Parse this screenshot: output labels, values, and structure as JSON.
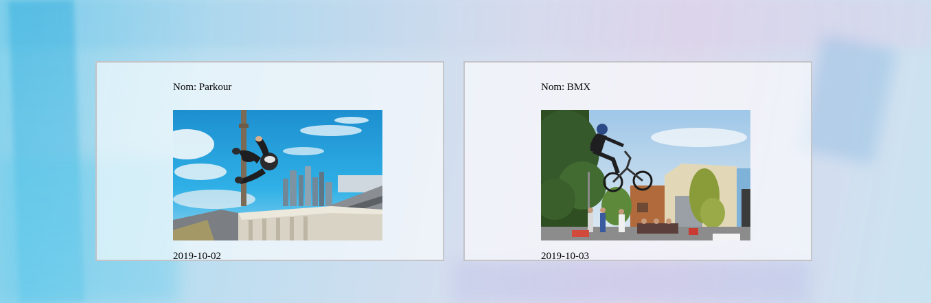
{
  "cards": [
    {
      "name": "Nom: Parkour",
      "date": "2019-10-02",
      "image": "parkour-photo"
    },
    {
      "name": "Nom: BMX",
      "date": "2019-10-03",
      "image": "bmx-photo"
    }
  ]
}
